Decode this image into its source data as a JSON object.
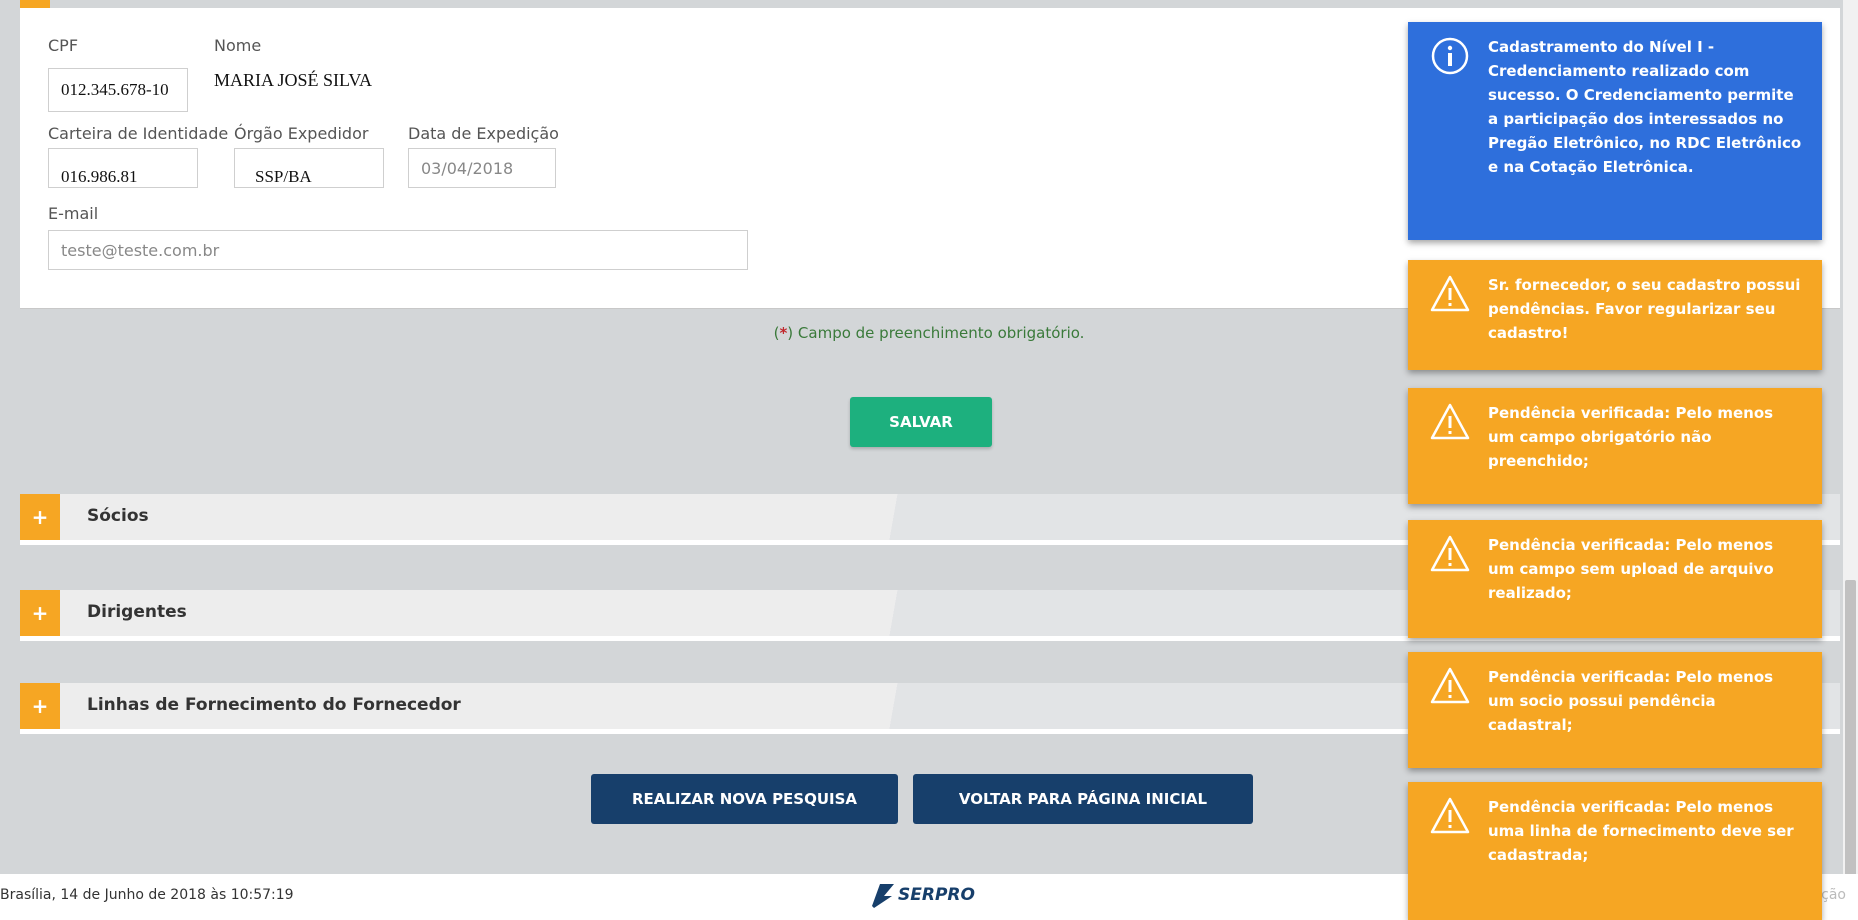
{
  "form": {
    "cpf_label": "CPF",
    "cpf_value": "012.345.678-10",
    "nome_label": "Nome",
    "nome_value": "MARIA JOSÉ SILVA",
    "rg_label": "Carteira de Identidade",
    "rg_value": "016.986.81",
    "orgao_label": "Órgão Expedidor",
    "orgao_value": "SSP/BA",
    "data_label": "Data de Expedição",
    "data_value": "03/04/2018",
    "email_label": "E-mail",
    "email_value": "teste@teste.com.br"
  },
  "required_note": {
    "open": "(",
    "asterisk": "*",
    "text": ") Campo de preenchimento obrigatório."
  },
  "buttons": {
    "save": "SALVAR",
    "new_search": "REALIZAR NOVA PESQUISA",
    "home": "VOLTAR PARA PÁGINA INICIAL"
  },
  "sections": [
    {
      "title": "Sócios",
      "toggle": "+"
    },
    {
      "title": "Dirigentes",
      "toggle": "+"
    },
    {
      "title": "Linhas de Fornecimento do Fornecedor",
      "toggle": "+"
    }
  ],
  "footer": {
    "date": "Brasília, 14 de Junho de 2018 às 10:57:19",
    "logo_text": "SERPRO",
    "environment": "Homologação"
  },
  "notifications": [
    {
      "type": "info",
      "icon": "info-icon",
      "color": "#2e6fdc",
      "text": "Cadastramento do Nível I - Credenciamento realizado com sucesso. O Credenciamento permite a participação dos interessados no Pregão Eletrônico, no RDC Eletrônico e na Cotação Eletrônica."
    },
    {
      "type": "warning",
      "icon": "warning-icon",
      "color": "#f6a623",
      "text": "Sr. fornecedor, o seu cadastro possui pendências. Favor regularizar seu cadastro!"
    },
    {
      "type": "warning",
      "icon": "warning-icon",
      "color": "#f6a623",
      "text": "Pendência verificada: Pelo menos um campo obrigatório não preenchido;"
    },
    {
      "type": "warning",
      "icon": "warning-icon",
      "color": "#f6a623",
      "text": "Pendência verificada: Pelo menos um campo sem upload de arquivo realizado;"
    },
    {
      "type": "warning",
      "icon": "warning-icon",
      "color": "#f6a623",
      "text": "Pendência verificada: Pelo menos um socio possui pendência cadastral;"
    },
    {
      "type": "warning",
      "icon": "warning-icon",
      "color": "#f6a623",
      "text": "Pendência verificada: Pelo menos uma linha de fornecimento deve ser cadastrada;"
    }
  ],
  "colors": {
    "accent": "#f6a623",
    "save_button": "#1db07e",
    "nav_button": "#173f6b",
    "info": "#2e6fdc"
  }
}
